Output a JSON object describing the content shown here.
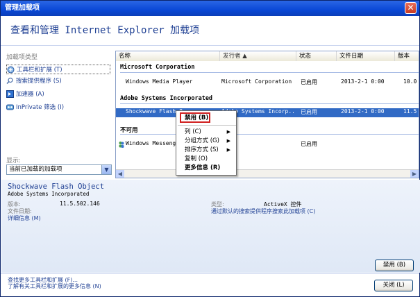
{
  "window": {
    "title": "管理加载项",
    "close_symbol": "✕"
  },
  "header": {
    "title": "查看和管理 Internet Explorer 加载项"
  },
  "left_panel": {
    "type_label": "加载项类型",
    "items": [
      {
        "label": "工具栏和扩展 (T)",
        "icon": "toolbar-icon"
      },
      {
        "label": "搜索提供程序 (S)",
        "icon": "search-icon"
      },
      {
        "label": "加速器 (A)",
        "icon": "accelerator-icon"
      },
      {
        "label": "InPrivate 筛选 (I)",
        "icon": "inprivate-icon"
      }
    ],
    "show_label": "显示:",
    "show_value": "当前已加载的加载项"
  },
  "list": {
    "columns": [
      "名称",
      "发行者 ▲",
      "状态",
      "文件日期",
      "版本"
    ],
    "groups": [
      {
        "name": "Microsoft Corporation",
        "rows": [
          {
            "name": "Windows Media Player",
            "publisher": "Microsoft Corporation",
            "status": "已启用",
            "date": "2013-2-1 0:00",
            "version": "10.0"
          }
        ]
      },
      {
        "name": "Adobe Systems Incorporated",
        "rows": [
          {
            "name": "Shockwave Flash O...",
            "publisher": "Adobe Systems Incorp...",
            "status": "已启用",
            "date": "2013-2-1 0:00",
            "version": "11.5"
          }
        ]
      },
      {
        "name": "不可用",
        "rows": [
          {
            "name": "Windows Messenger",
            "publisher": "",
            "status": "已启用",
            "date": "",
            "version": ""
          }
        ]
      }
    ]
  },
  "context_menu": {
    "items": [
      {
        "label": "禁用 (B)",
        "bold": true
      },
      {
        "label": "列 (C)",
        "sub": "▶"
      },
      {
        "label": "分组方式 (G)",
        "sub": "▶"
      },
      {
        "label": "排序方式 (S)",
        "sub": "▶"
      },
      {
        "label": "复制 (O)"
      },
      {
        "label": "更多信息 (R)",
        "bold": true
      }
    ]
  },
  "details": {
    "name": "Shockwave Flash Object",
    "publisher": "Adobe Systems Incorporated",
    "version_label": "版本:",
    "version_value": "11.5.502.146",
    "date_label": "文件日期:",
    "more_info_link": "详细信息 (M)",
    "type_label": "类型:",
    "type_value": "ActiveX 控件",
    "search_link": "通过默认的搜索提供程序搜索此加载项 (C)"
  },
  "buttons": {
    "disable": "禁用 (B)",
    "close": "关闭 (L)"
  },
  "footer": {
    "link1": "查找更多工具栏和扩展 (F)...",
    "link2": "了解有关工具栏和扩展的更多信息 (N)"
  }
}
